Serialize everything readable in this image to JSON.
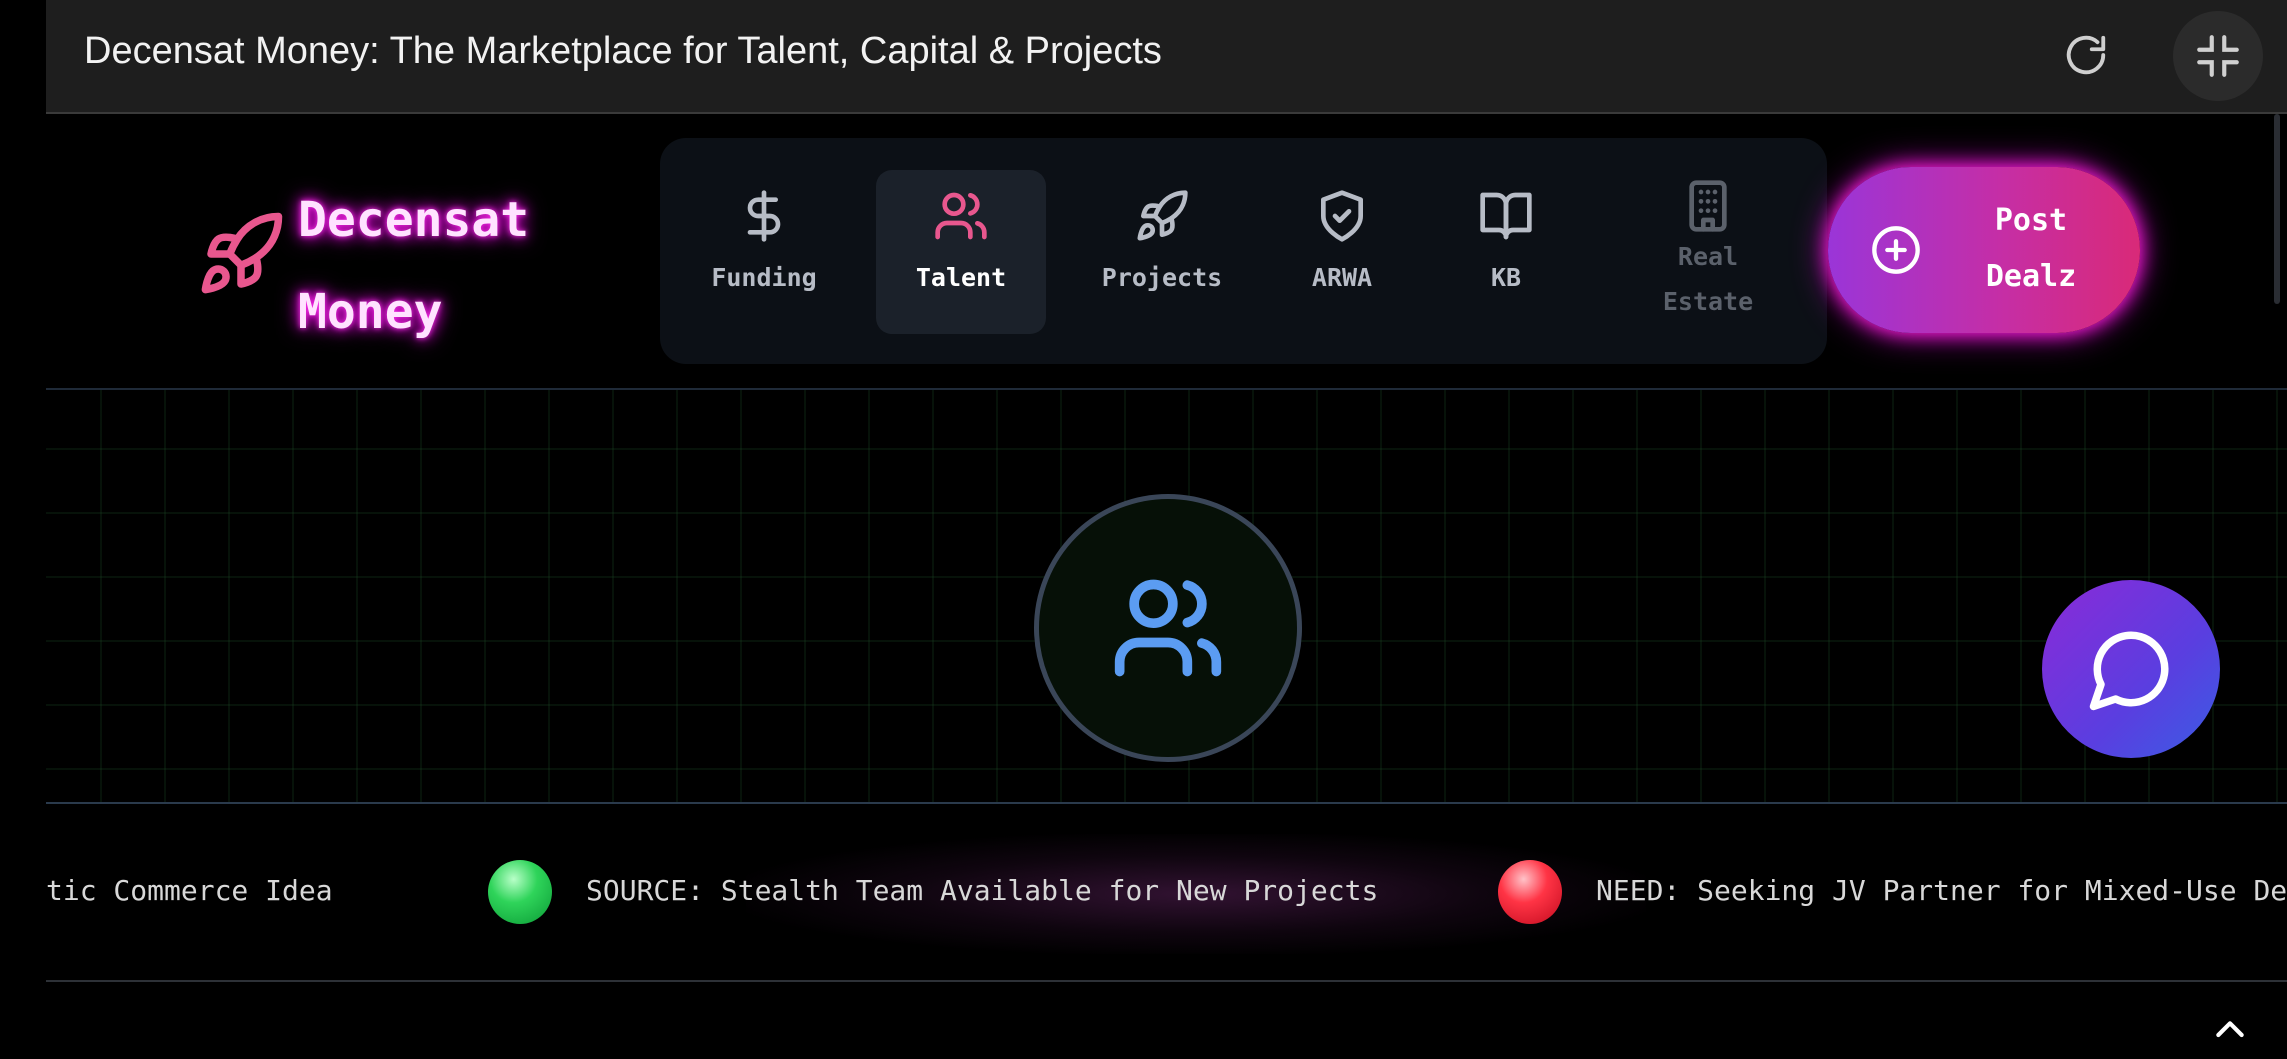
{
  "window": {
    "title": "Decensat Money: The Marketplace for Talent, Capital & Projects"
  },
  "logo": {
    "line1": "Decensat",
    "line2": "Money",
    "icon": "rocket-icon"
  },
  "nav": {
    "items": [
      {
        "label": "Funding",
        "icon": "dollar-icon",
        "state": "default"
      },
      {
        "label": "Talent",
        "icon": "users-icon",
        "state": "active"
      },
      {
        "label": "Projects",
        "icon": "rocket-icon",
        "state": "default"
      },
      {
        "label": "ARWA",
        "icon": "shield-check-icon",
        "state": "default"
      },
      {
        "label": "KB",
        "icon": "book-icon",
        "state": "default"
      },
      {
        "label": "Real Estate",
        "label_line1": "Real",
        "label_line2": "Estate",
        "icon": "building-icon",
        "state": "disabled"
      }
    ]
  },
  "post_button": {
    "line1": "Post",
    "line2": "Dealz",
    "icon": "plus-circle-icon"
  },
  "hero": {
    "icon": "users-icon"
  },
  "chat": {
    "icon": "chat-bubble-icon"
  },
  "ticker": {
    "items": [
      {
        "text": "tic Commerce Idea",
        "status": "none"
      },
      {
        "text": "SOURCE: Stealth Team Available for New Projects",
        "status": "green"
      },
      {
        "text": "NEED: Seeking JV Partner for Mixed-Use Devel",
        "status": "red"
      }
    ]
  },
  "colors": {
    "accent_pink": "#e8578e",
    "neon_magenta": "#ff33ee",
    "hero_icon_blue": "#5b9cf2",
    "status_green": "#2fd45a",
    "status_red": "#ff3445"
  }
}
